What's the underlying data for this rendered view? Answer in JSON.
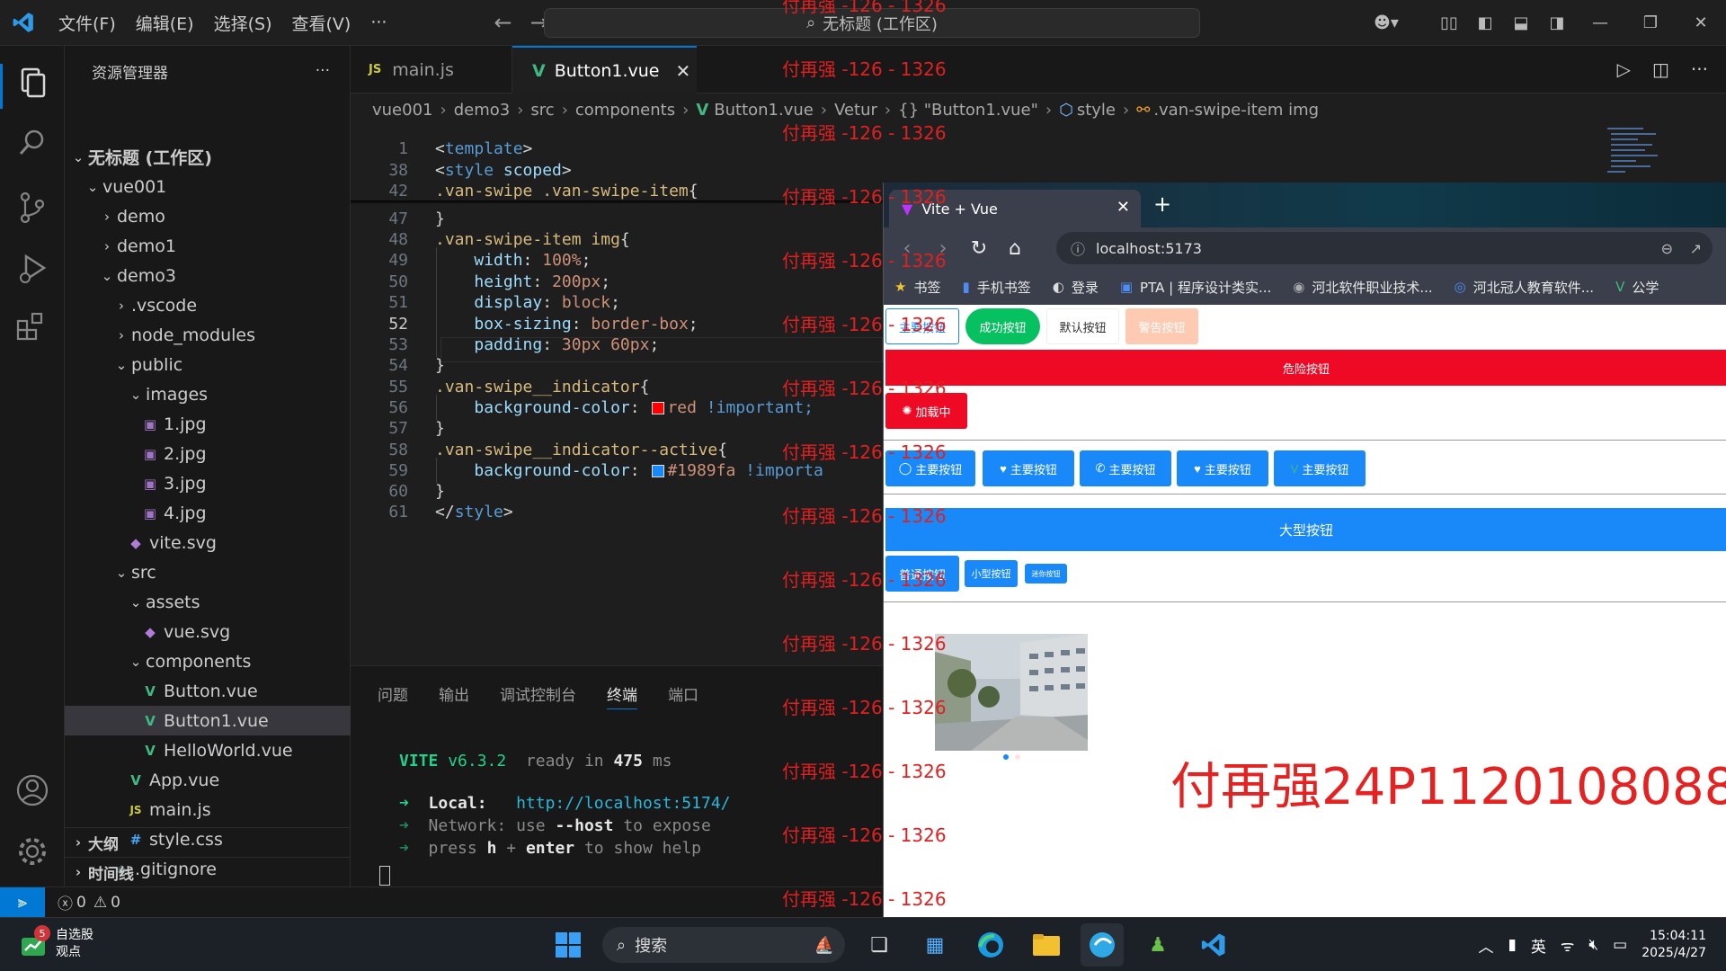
{
  "titlebar": {
    "menu": [
      "文件(F)",
      "编辑(E)",
      "选择(S)",
      "查看(V)",
      "···"
    ],
    "search_text": "无标题 (工作区)"
  },
  "sidebar": {
    "title": "资源管理器",
    "more": "···",
    "tree": [
      {
        "label": "无标题 (工作区)",
        "indent": 0,
        "chev": "v",
        "kind": "root"
      },
      {
        "label": "vue001",
        "indent": 1,
        "chev": "v",
        "kind": "folder"
      },
      {
        "label": "demo",
        "indent": 2,
        "chev": ">",
        "kind": "folder"
      },
      {
        "label": "demo1",
        "indent": 2,
        "chev": ">",
        "kind": "folder"
      },
      {
        "label": "demo3",
        "indent": 2,
        "chev": "v",
        "kind": "folder"
      },
      {
        "label": ".vscode",
        "indent": 3,
        "chev": ">",
        "kind": "folder"
      },
      {
        "label": "node_modules",
        "indent": 3,
        "chev": ">",
        "kind": "folder"
      },
      {
        "label": "public",
        "indent": 3,
        "chev": "v",
        "kind": "folder"
      },
      {
        "label": "images",
        "indent": 4,
        "chev": "v",
        "kind": "folder"
      },
      {
        "label": "1.jpg",
        "indent": 5,
        "chev": "",
        "kind": "img"
      },
      {
        "label": "2.jpg",
        "indent": 5,
        "chev": "",
        "kind": "img"
      },
      {
        "label": "3.jpg",
        "indent": 5,
        "chev": "",
        "kind": "img"
      },
      {
        "label": "4.jpg",
        "indent": 5,
        "chev": "",
        "kind": "img"
      },
      {
        "label": "vite.svg",
        "indent": 4,
        "chev": "",
        "kind": "svg"
      },
      {
        "label": "src",
        "indent": 3,
        "chev": "v",
        "kind": "folder"
      },
      {
        "label": "assets",
        "indent": 4,
        "chev": "v",
        "kind": "folder"
      },
      {
        "label": "vue.svg",
        "indent": 5,
        "chev": "",
        "kind": "svg"
      },
      {
        "label": "components",
        "indent": 4,
        "chev": "v",
        "kind": "folder"
      },
      {
        "label": "Button.vue",
        "indent": 5,
        "chev": "",
        "kind": "vue"
      },
      {
        "label": "Button1.vue",
        "indent": 5,
        "chev": "",
        "kind": "vue",
        "selected": true
      },
      {
        "label": "HelloWorld.vue",
        "indent": 5,
        "chev": "",
        "kind": "vue"
      },
      {
        "label": "App.vue",
        "indent": 4,
        "chev": "",
        "kind": "vue"
      },
      {
        "label": "main.js",
        "indent": 4,
        "chev": "",
        "kind": "js"
      },
      {
        "label": "style.css",
        "indent": 4,
        "chev": "",
        "kind": "css"
      },
      {
        "label": ".gitignore",
        "indent": 3,
        "chev": "",
        "kind": "git"
      }
    ],
    "outline": "大纲",
    "timeline": "时间线"
  },
  "tabs": [
    {
      "label": "main.js",
      "icon": "JS"
    },
    {
      "label": "Button1.vue",
      "icon": "V",
      "close": "✕"
    }
  ],
  "breadcrumb": [
    "vue001",
    "demo3",
    "src",
    "components",
    "Button1.vue",
    "Vetur",
    "{} \"Button1.vue\"",
    "style",
    ".van-swipe-item img"
  ],
  "code": [
    {
      "n": "1",
      "text": "<template>"
    },
    {
      "n": "38",
      "text": "<style scoped>"
    },
    {
      "n": "42",
      "text": ".van-swipe .van-swipe-item{"
    },
    {
      "n": "47",
      "text": "}"
    },
    {
      "n": "48",
      "text": ".van-swipe-item img{"
    },
    {
      "n": "49",
      "text": "    width: 100%;"
    },
    {
      "n": "50",
      "text": "    height: 200px;"
    },
    {
      "n": "51",
      "text": "    display: block;"
    },
    {
      "n": "52",
      "text": "    box-sizing: border-box;"
    },
    {
      "n": "53",
      "text": "    padding: 30px 60px;"
    },
    {
      "n": "54",
      "text": "}"
    },
    {
      "n": "55",
      "text": ".van-swipe__indicator{"
    },
    {
      "n": "56",
      "text": "    background-color: ",
      "swatch": "#ff0000",
      "after": "red !important;"
    },
    {
      "n": "57",
      "text": "}"
    },
    {
      "n": "58",
      "text": ".van-swipe__indicator--active{"
    },
    {
      "n": "59",
      "text": "    background-color: ",
      "swatch": "#1989fa",
      "after": "#1989fa !importa"
    },
    {
      "n": "60",
      "text": "}"
    },
    {
      "n": "61",
      "text": "</style>"
    }
  ],
  "current_line": "52",
  "panel": {
    "tabs": [
      "问题",
      "输出",
      "调试控制台",
      "终端",
      "端口"
    ],
    "active_tab": "终端",
    "terminal": {
      "vite": "VITE",
      "version": "v6.3.2",
      "ready": "ready in",
      "ms": "475",
      "ms_unit": "ms",
      "local_label": "Local:",
      "local_url": "http://localhost:5174/",
      "network_label": "Network:",
      "network_text": "use",
      "network_flag": "--host",
      "network_tail": "to expose",
      "press": "press",
      "key_h": "h",
      "plus": "+",
      "key_enter": "enter",
      "press_tail": "to show help"
    }
  },
  "statusbar": {
    "errors": "0",
    "warnings": "0"
  },
  "browser": {
    "tab_title": "Vite + Vue",
    "url": "localhost:5173",
    "bookmarks": [
      "书签",
      "手机书签",
      "登录",
      "PTA | 程序设计类实...",
      "河北软件职业技术...",
      "河北冠人教育软件...",
      "公学"
    ],
    "buttons_row1": [
      "主要按钮",
      "成功按钮",
      "默认按钮",
      "警告按钮"
    ],
    "danger": "危险按钮",
    "loading": "加载中",
    "icon_buttons": [
      "主要按钮",
      "主要按钮",
      "主要按钮",
      "主要按钮",
      "主要按钮"
    ],
    "large": "大型按钮",
    "sizes": [
      "普通按钮",
      "小型按钮",
      "迷你按钮"
    ],
    "primary_color": "#1989fa",
    "success_color": "#07c160",
    "danger_color": "#ee0a24",
    "warning_color": "#ff976a"
  },
  "watermark": {
    "repeat": "付再强 -126 - 1326",
    "big": "付再强24P1120108088"
  },
  "taskbar": {
    "stock_title": "自选股",
    "stock_sub": "观点",
    "stock_badge": "5",
    "search": "搜索",
    "ime": "英",
    "time": "15:04:11",
    "date": "2025/4/27"
  }
}
